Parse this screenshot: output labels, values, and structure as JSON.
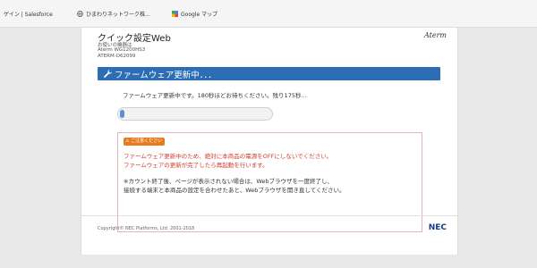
{
  "bookmarks": [
    {
      "label": "ゲイン | Salesforce",
      "icon": "none"
    },
    {
      "label": "ひまわりネットワーク株...",
      "icon": "globe-icon"
    },
    {
      "label": "Google マップ",
      "icon": "google-maps-icon"
    }
  ],
  "header": {
    "title": "クイック設定Web",
    "device_label": "お使いの機器は",
    "model": "Aterm WG1200HS3",
    "device_id": "ATERM-D62099",
    "brand": "Aterm"
  },
  "banner": {
    "title": "ファームウェア更新中．．．",
    "color": "#2c6db5"
  },
  "status": {
    "message": "ファームウェア更新中です。180秒ほどお待ちください。残り175秒…",
    "progress": 0.03
  },
  "notice": {
    "badge": "ご注意ください",
    "warning_line1": "ファームウェア更新中のため、絶対に本商品の電源をOFFにしないでください。",
    "warning_line2": "ファームウェアの更新が完了したら再起動を行います。",
    "note_line1": "※カウント終了後、ページが表示されない場合は、Webブラウザを一度終了し、",
    "note_line2": "接続する端末と本商品の設定を合わせたあと、Webブラウザを開き直してください。",
    "warning_color": "#d23c2c",
    "badge_color": "#e87a1d"
  },
  "footer": {
    "copyright": "Copyright© NEC Platforms, Ltd. 2001-2018",
    "logo": "NEC"
  }
}
